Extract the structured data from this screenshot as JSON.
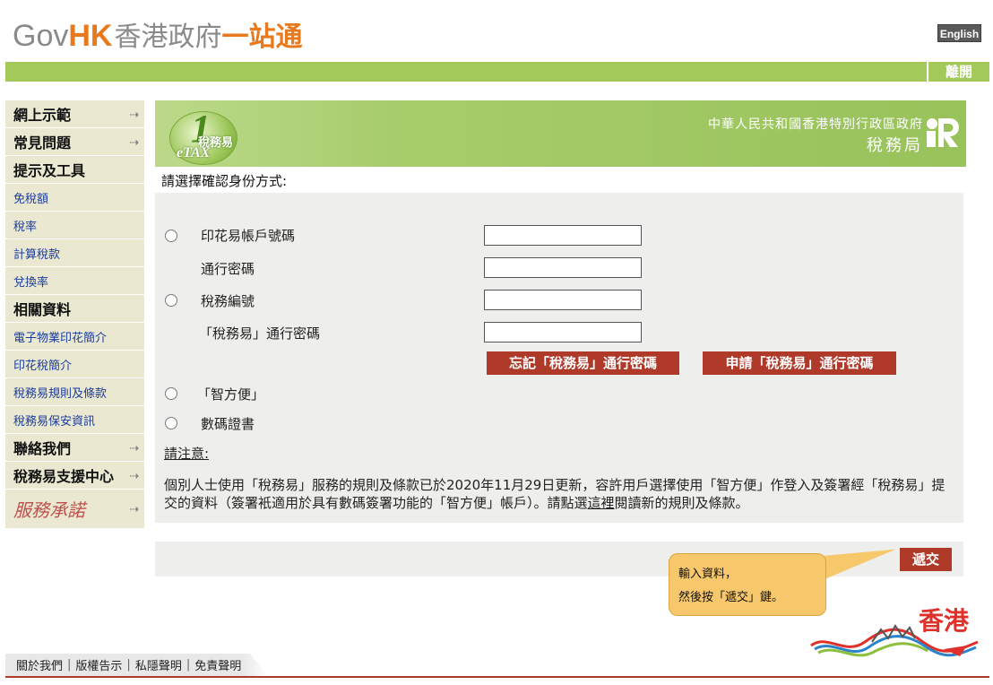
{
  "header": {
    "logo_gov": "Gov",
    "logo_hk": "HK",
    "logo_cn_gray": "香港政府",
    "logo_cn_orange": "一站通",
    "language_button": "English",
    "exit_button": "離開"
  },
  "sidebar": {
    "items": [
      {
        "label": "網上示範",
        "type": "heading",
        "arrow": "+"
      },
      {
        "label": "常見問題",
        "type": "heading",
        "arrow": "+"
      },
      {
        "label": "提示及工具",
        "type": "heading"
      },
      {
        "label": "免稅額",
        "type": "link"
      },
      {
        "label": "稅率",
        "type": "link"
      },
      {
        "label": "計算稅款",
        "type": "link"
      },
      {
        "label": "兌換率",
        "type": "link"
      },
      {
        "label": "相關資料",
        "type": "heading"
      },
      {
        "label": "電子物業印花簡介",
        "type": "link"
      },
      {
        "label": "印花稅簡介",
        "type": "link"
      },
      {
        "label": "稅務易規則及條款",
        "type": "link"
      },
      {
        "label": "稅務易保安資訊",
        "type": "link"
      },
      {
        "label": "聯絡我們",
        "type": "heading",
        "arrow": "+"
      },
      {
        "label": "稅務易支援中心",
        "type": "heading",
        "arrow": "+"
      },
      {
        "label": "服務承諾",
        "type": "service",
        "arrow": "+"
      }
    ]
  },
  "banner": {
    "etax_cn": "稅務易",
    "etax_en": "eTAX",
    "dept_line1": "中華人民共和國香港特別行政區政府",
    "dept_line2": "稅務局"
  },
  "form": {
    "prompt": "請選擇確認身份方式:",
    "option_stamp_account": "印花易帳戶號碼",
    "label_password": "通行密碼",
    "option_tax_file": "稅務編號",
    "label_etax_password": "「稅務易」通行密碼",
    "forgot_button": "忘記「稅務易」通行密碼",
    "apply_button": "申請「稅務易」通行密碼",
    "option_iam_smart": "「智方便」",
    "option_digital_cert": "數碼證書",
    "stamp_account_value": "",
    "password_value": "",
    "tax_file_value": "",
    "etax_password_value": ""
  },
  "notice": {
    "title": "請注意:",
    "body_part1": "個別人士使用「稅務易」服務的規則及條款已於2020年11月29日更新，容許用戶選擇使用「智方便」作登入及簽署經「稅務易」提交的資料（簽署衹適用於具有數碼簽署功能的「智方便」帳戶）。請點選",
    "body_link": "這裡",
    "body_part2": "閱讀新的規則及條款。"
  },
  "submit": {
    "button": "遞交",
    "tip_line1": "輸入資料，",
    "tip_line2": "然後按「遞交」鍵。"
  },
  "brand": {
    "hk_text": "香港"
  },
  "footer": {
    "links": [
      "關於我們",
      "版權告示",
      "私隱聲明",
      "免責聲明"
    ]
  },
  "colors": {
    "green_bar": "#a4c85a",
    "red_button": "#b03a2a",
    "sidebar_bg": "#ebe8d1",
    "panel_bg": "#eeeeec",
    "tip_bg": "#f6c76b"
  }
}
